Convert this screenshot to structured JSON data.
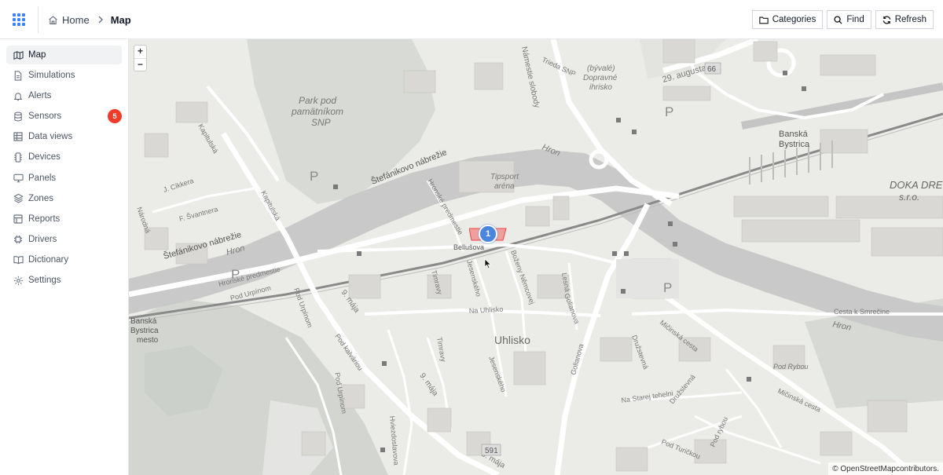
{
  "header": {
    "breadcrumb": {
      "home_label": "Home",
      "current_label": "Map"
    },
    "actions": {
      "categories_label": "Categories",
      "find_label": "Find",
      "refresh_label": "Refresh"
    }
  },
  "sidebar": {
    "items": [
      {
        "label": "Map",
        "icon": "map-icon",
        "active": true
      },
      {
        "label": "Simulations",
        "icon": "document-icon"
      },
      {
        "label": "Alerts",
        "icon": "bell-icon"
      },
      {
        "label": "Sensors",
        "icon": "database-icon",
        "badge": "5"
      },
      {
        "label": "Data views",
        "icon": "table-icon"
      },
      {
        "label": "Devices",
        "icon": "device-icon"
      },
      {
        "label": "Panels",
        "icon": "monitor-icon"
      },
      {
        "label": "Zones",
        "icon": "layers-icon"
      },
      {
        "label": "Reports",
        "icon": "report-icon"
      },
      {
        "label": "Drivers",
        "icon": "chip-icon"
      },
      {
        "label": "Dictionary",
        "icon": "book-icon"
      },
      {
        "label": "Settings",
        "icon": "gear-icon"
      }
    ]
  },
  "map": {
    "zoom_in": "+",
    "zoom_out": "−",
    "cluster_count": "1",
    "attribution_prefix": "©",
    "attribution_link": "OpenStreetMap",
    "attribution_suffix": " contributors.",
    "labels": {
      "park": [
        "Park pod",
        "pamätníkom",
        "SNP"
      ],
      "square": [
        "Námestie slobody"
      ],
      "trieda": "Trieda SNP",
      "augusta": "29. augusta",
      "road66": "66",
      "byvale": [
        "(bývalé)",
        "Dopravné",
        "ihrisko"
      ],
      "parking": "P",
      "banska": [
        "Banská",
        "Bystrica"
      ],
      "hron": "Hron",
      "tipsport": [
        "Tipsport",
        "aréna"
      ],
      "doka": [
        "DOKA DRE",
        "s.r.o."
      ],
      "cikkera": "J. Cikkera",
      "svantnera": "F. Švantnera",
      "kapitulska": "Kapitulská",
      "narodna": "Národná",
      "stefanikovo": "Štefánikovo nábrežie",
      "hronske": "Hronské predmestie",
      "hronske2": "Hronské predmestie",
      "pod_urpinom": "Pod Urpínom",
      "pod_urpinom2": "Pod Urpínom",
      "pod_urpinom3": "Pod Urpínom",
      "mesto": [
        "Banská",
        "Bystrica",
        "mesto"
      ],
      "maja": "9. mája",
      "maja2": "9. mája",
      "maja3": "9. mája",
      "kalvariou": "Pod kalváriou",
      "bellusova": "Bellušova",
      "jesenskeho": "Jesenského",
      "jesenskeho2": "Jesenského",
      "timravy": "Timravy",
      "timravy2": "Timravy",
      "bozeny": "Boženy Němcovej",
      "lesna": "Lesná",
      "golianova": "Golianova",
      "golianova2": "Golianova",
      "na_uhlisko": "Na Uhlisko",
      "uhlisko": "Uhlisko",
      "druzstevna": "Družstevná",
      "druzstevna2": "Družstevná",
      "micinska": "Mičinská cesta",
      "micinska2": "Mičinská cesta",
      "cesta_smrecine": "Cesta k Smrečine",
      "pod_rybou": "Pod Rybou",
      "pod_rybou2": "Pod rybou",
      "na_starej": "Na Starej tehelni",
      "pod_turickou": "Pod Turičkou",
      "hviezdoslavova": "Hviezdoslavova",
      "road591": "591"
    }
  }
}
